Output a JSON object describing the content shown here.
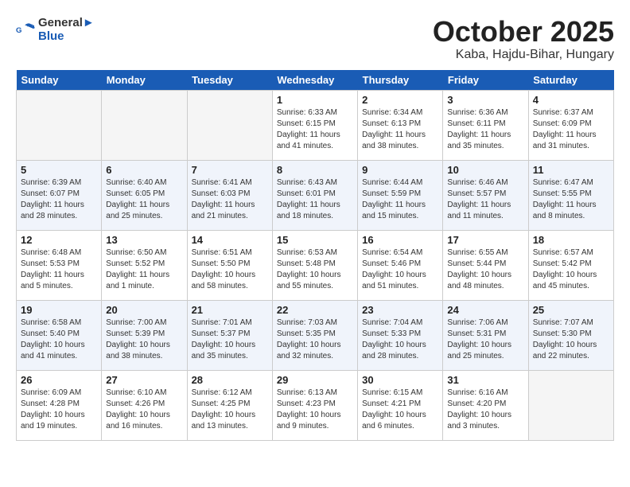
{
  "header": {
    "logo_line1": "General",
    "logo_line2": "Blue",
    "month": "October 2025",
    "location": "Kaba, Hajdu-Bihar, Hungary"
  },
  "columns": [
    "Sunday",
    "Monday",
    "Tuesday",
    "Wednesday",
    "Thursday",
    "Friday",
    "Saturday"
  ],
  "weeks": [
    [
      {
        "day": "",
        "info": ""
      },
      {
        "day": "",
        "info": ""
      },
      {
        "day": "",
        "info": ""
      },
      {
        "day": "1",
        "info": "Sunrise: 6:33 AM\nSunset: 6:15 PM\nDaylight: 11 hours\nand 41 minutes."
      },
      {
        "day": "2",
        "info": "Sunrise: 6:34 AM\nSunset: 6:13 PM\nDaylight: 11 hours\nand 38 minutes."
      },
      {
        "day": "3",
        "info": "Sunrise: 6:36 AM\nSunset: 6:11 PM\nDaylight: 11 hours\nand 35 minutes."
      },
      {
        "day": "4",
        "info": "Sunrise: 6:37 AM\nSunset: 6:09 PM\nDaylight: 11 hours\nand 31 minutes."
      }
    ],
    [
      {
        "day": "5",
        "info": "Sunrise: 6:39 AM\nSunset: 6:07 PM\nDaylight: 11 hours\nand 28 minutes."
      },
      {
        "day": "6",
        "info": "Sunrise: 6:40 AM\nSunset: 6:05 PM\nDaylight: 11 hours\nand 25 minutes."
      },
      {
        "day": "7",
        "info": "Sunrise: 6:41 AM\nSunset: 6:03 PM\nDaylight: 11 hours\nand 21 minutes."
      },
      {
        "day": "8",
        "info": "Sunrise: 6:43 AM\nSunset: 6:01 PM\nDaylight: 11 hours\nand 18 minutes."
      },
      {
        "day": "9",
        "info": "Sunrise: 6:44 AM\nSunset: 5:59 PM\nDaylight: 11 hours\nand 15 minutes."
      },
      {
        "day": "10",
        "info": "Sunrise: 6:46 AM\nSunset: 5:57 PM\nDaylight: 11 hours\nand 11 minutes."
      },
      {
        "day": "11",
        "info": "Sunrise: 6:47 AM\nSunset: 5:55 PM\nDaylight: 11 hours\nand 8 minutes."
      }
    ],
    [
      {
        "day": "12",
        "info": "Sunrise: 6:48 AM\nSunset: 5:53 PM\nDaylight: 11 hours\nand 5 minutes."
      },
      {
        "day": "13",
        "info": "Sunrise: 6:50 AM\nSunset: 5:52 PM\nDaylight: 11 hours\nand 1 minute."
      },
      {
        "day": "14",
        "info": "Sunrise: 6:51 AM\nSunset: 5:50 PM\nDaylight: 10 hours\nand 58 minutes."
      },
      {
        "day": "15",
        "info": "Sunrise: 6:53 AM\nSunset: 5:48 PM\nDaylight: 10 hours\nand 55 minutes."
      },
      {
        "day": "16",
        "info": "Sunrise: 6:54 AM\nSunset: 5:46 PM\nDaylight: 10 hours\nand 51 minutes."
      },
      {
        "day": "17",
        "info": "Sunrise: 6:55 AM\nSunset: 5:44 PM\nDaylight: 10 hours\nand 48 minutes."
      },
      {
        "day": "18",
        "info": "Sunrise: 6:57 AM\nSunset: 5:42 PM\nDaylight: 10 hours\nand 45 minutes."
      }
    ],
    [
      {
        "day": "19",
        "info": "Sunrise: 6:58 AM\nSunset: 5:40 PM\nDaylight: 10 hours\nand 41 minutes."
      },
      {
        "day": "20",
        "info": "Sunrise: 7:00 AM\nSunset: 5:39 PM\nDaylight: 10 hours\nand 38 minutes."
      },
      {
        "day": "21",
        "info": "Sunrise: 7:01 AM\nSunset: 5:37 PM\nDaylight: 10 hours\nand 35 minutes."
      },
      {
        "day": "22",
        "info": "Sunrise: 7:03 AM\nSunset: 5:35 PM\nDaylight: 10 hours\nand 32 minutes."
      },
      {
        "day": "23",
        "info": "Sunrise: 7:04 AM\nSunset: 5:33 PM\nDaylight: 10 hours\nand 28 minutes."
      },
      {
        "day": "24",
        "info": "Sunrise: 7:06 AM\nSunset: 5:31 PM\nDaylight: 10 hours\nand 25 minutes."
      },
      {
        "day": "25",
        "info": "Sunrise: 7:07 AM\nSunset: 5:30 PM\nDaylight: 10 hours\nand 22 minutes."
      }
    ],
    [
      {
        "day": "26",
        "info": "Sunrise: 6:09 AM\nSunset: 4:28 PM\nDaylight: 10 hours\nand 19 minutes."
      },
      {
        "day": "27",
        "info": "Sunrise: 6:10 AM\nSunset: 4:26 PM\nDaylight: 10 hours\nand 16 minutes."
      },
      {
        "day": "28",
        "info": "Sunrise: 6:12 AM\nSunset: 4:25 PM\nDaylight: 10 hours\nand 13 minutes."
      },
      {
        "day": "29",
        "info": "Sunrise: 6:13 AM\nSunset: 4:23 PM\nDaylight: 10 hours\nand 9 minutes."
      },
      {
        "day": "30",
        "info": "Sunrise: 6:15 AM\nSunset: 4:21 PM\nDaylight: 10 hours\nand 6 minutes."
      },
      {
        "day": "31",
        "info": "Sunrise: 6:16 AM\nSunset: 4:20 PM\nDaylight: 10 hours\nand 3 minutes."
      },
      {
        "day": "",
        "info": ""
      }
    ]
  ]
}
